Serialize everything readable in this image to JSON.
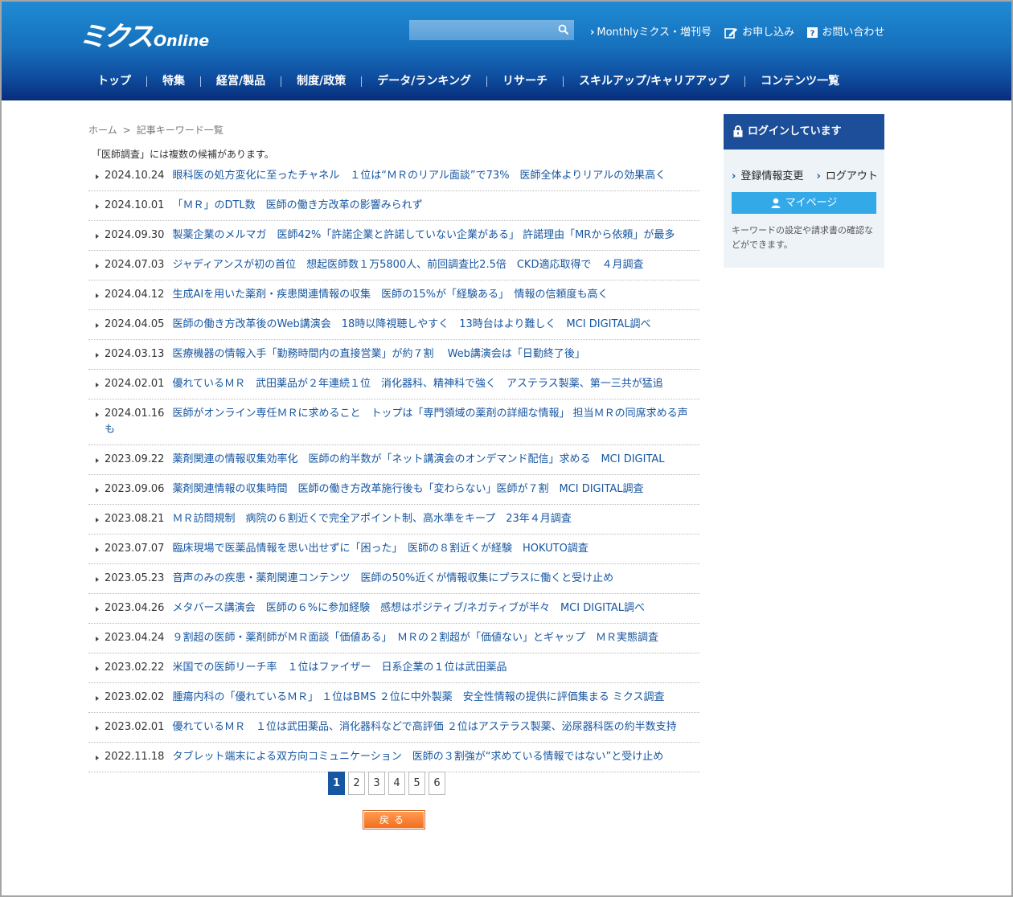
{
  "logo": {
    "main": "ミクス",
    "sub": "Online"
  },
  "search": {
    "placeholder": "",
    "value": ""
  },
  "toplinks": {
    "monthly": "Monthlyミクス・増刊号",
    "apply": "お申し込み",
    "contact": "お問い合わせ"
  },
  "nav": [
    "トップ",
    "特集",
    "経営/製品",
    "制度/政策",
    "データ/ランキング",
    "リサーチ",
    "スキルアップ/キャリアアップ",
    "コンテンツ一覧"
  ],
  "breadcrumb": {
    "home": "ホーム",
    "sep": ">",
    "current": "記事キーワード一覧"
  },
  "notice": "「医師調査」には複数の候補があります。",
  "articles": [
    {
      "date": "2024.10.24",
      "title": "眼科医の処方変化に至ったチャネル　１位は“ＭＲのリアル面談”で73%　医師全体よりリアルの効果高く"
    },
    {
      "date": "2024.10.01",
      "title": "「ＭＲ」のDTL数　医師の働き方改革の影響みられず"
    },
    {
      "date": "2024.09.30",
      "title": "製薬企業のメルマガ　医師42%「許諾企業と許諾していない企業がある」 許諾理由「MRから依頼」が最多"
    },
    {
      "date": "2024.07.03",
      "title": "ジャディアンスが初の首位　想起医師数１万5800人、前回調査比2.5倍　CKD適応取得で　４月調査"
    },
    {
      "date": "2024.04.12",
      "title": "生成AIを用いた薬剤・疾患関連情報の収集　医師の15%が「経験ある」　情報の信頼度も高く"
    },
    {
      "date": "2024.04.05",
      "title": "医師の働き方改革後のWeb講演会　18時以降視聴しやすく　13時台はより難しく　MCI DIGITAL調べ"
    },
    {
      "date": "2024.03.13",
      "title": "医療機器の情報入手「勤務時間内の直接営業」が約７割　 Web講演会は「日勤終了後」"
    },
    {
      "date": "2024.02.01",
      "title": "優れているＭＲ　武田薬品が２年連続１位　消化器科、精神科で強く　アステラス製薬、第一三共が猛追"
    },
    {
      "date": "2024.01.16",
      "title": "医師がオンライン専任ＭＲに求めること　トップは「専門領域の薬剤の詳細な情報」 担当ＭＲの同席求める声も"
    },
    {
      "date": "2023.09.22",
      "title": "薬剤関連の情報収集効率化　医師の約半数が「ネット講演会のオンデマンド配信」求める　MCI DIGITAL"
    },
    {
      "date": "2023.09.06",
      "title": "薬剤関連情報の収集時間　医師の働き方改革施行後も「変わらない」医師が７割　MCI DIGITAL調査"
    },
    {
      "date": "2023.08.21",
      "title": "ＭＲ訪問規制　病院の６割近くで完全アポイント制、高水準をキープ　23年４月調査"
    },
    {
      "date": "2023.07.07",
      "title": "臨床現場で医薬品情報を思い出せずに「困った」　医師の８割近くが経験　HOKUTO調査"
    },
    {
      "date": "2023.05.23",
      "title": "音声のみの疾患・薬剤関連コンテンツ　医師の50%近くが情報収集にプラスに働くと受け止め"
    },
    {
      "date": "2023.04.26",
      "title": "メタバース講演会　医師の６%に参加経験　感想はポジティブ/ネガティブが半々　MCI DIGITAL調べ"
    },
    {
      "date": "2023.04.24",
      "title": "９割超の医師・薬剤師がＭＲ面談「価値ある」　ＭＲの２割超が「価値ない」とギャップ　ＭＲ実態調査"
    },
    {
      "date": "2023.02.22",
      "title": "米国での医師リーチ率　１位はファイザー　日系企業の１位は武田薬品"
    },
    {
      "date": "2023.02.02",
      "title": "腫瘍内科の「優れているＭＲ」 １位はBMS ２位に中外製薬　安全性情報の提供に評価集まる ミクス調査"
    },
    {
      "date": "2023.02.01",
      "title": "優れているＭＲ　１位は武田薬品、消化器科などで高評価 ２位はアステラス製薬、泌尿器科医の約半数支持"
    },
    {
      "date": "2022.11.18",
      "title": "タブレット端末による双方向コミュニケーション　医師の３割強が“求めている情報ではない”と受け止め"
    }
  ],
  "pager": {
    "pages": [
      "1",
      "2",
      "3",
      "4",
      "5",
      "6"
    ],
    "current": "1"
  },
  "back_label": "戻る",
  "sidebar": {
    "header": "ログインしています",
    "link_register": "登録情報変更",
    "link_logout": "ログアウト",
    "mypage": "マイページ",
    "desc": "キーワードの設定や請求書の確認などができます。"
  },
  "colors": {
    "header_top": "#1f8bd4",
    "header_bottom": "#072d7b",
    "link": "#1756a0",
    "sidebar_head": "#1c4e9a",
    "mypage": "#33a9e8",
    "back_button": "#f26d1c"
  }
}
